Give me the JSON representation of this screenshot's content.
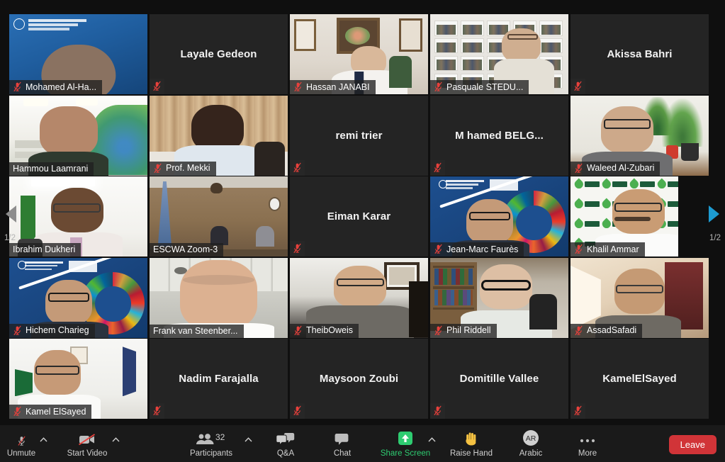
{
  "meeting": {
    "view": "gallery",
    "page_indicator_left": "1/2",
    "page_indicator_right": "1/2",
    "active_speaker": "Hammou Laamrani",
    "speaking_border_color": "#d7f205",
    "background_color": "#0f0f0f",
    "tile_color": "#242424"
  },
  "participants": [
    {
      "name": "Mohamed Al-Ha...",
      "video": true,
      "muted": true,
      "speaking": false,
      "bg": "fao-blue"
    },
    {
      "name": "Layale Gedeon",
      "video": false,
      "muted": true,
      "speaking": false,
      "bg": "none"
    },
    {
      "name": "Hassan JANABI",
      "video": true,
      "muted": true,
      "speaking": false,
      "bg": "room-art"
    },
    {
      "name": "Pasquale STEDU...",
      "video": true,
      "muted": true,
      "speaking": false,
      "bg": "bookshelf"
    },
    {
      "name": "Akissa Bahri",
      "video": false,
      "muted": true,
      "speaking": false,
      "bg": "none"
    },
    {
      "name": "Hammou Laamrani",
      "video": true,
      "muted": false,
      "speaking": true,
      "bg": "banner-light"
    },
    {
      "name": "Prof. Mekki",
      "video": true,
      "muted": true,
      "speaking": false,
      "bg": "curtain"
    },
    {
      "name": "remi trier",
      "video": false,
      "muted": true,
      "speaking": false,
      "bg": "none"
    },
    {
      "name": "M hamed BELG...",
      "video": false,
      "muted": true,
      "speaking": false,
      "bg": "none"
    },
    {
      "name": "Waleed Al-Zubari",
      "video": true,
      "muted": true,
      "speaking": false,
      "bg": "plants"
    },
    {
      "name": "Ibrahim Dukheri",
      "video": true,
      "muted": false,
      "speaking": false,
      "bg": "office-white"
    },
    {
      "name": "ESCWA Zoom-3",
      "video": true,
      "muted": false,
      "speaking": false,
      "bg": "conference"
    },
    {
      "name": "Eiman Karar",
      "video": false,
      "muted": true,
      "speaking": false,
      "bg": "none"
    },
    {
      "name": "Jean-Marc Faurès",
      "video": true,
      "muted": true,
      "speaking": false,
      "bg": "fao-sdg"
    },
    {
      "name": "Khalil Ammar",
      "video": true,
      "muted": true,
      "speaking": false,
      "bg": "icba"
    },
    {
      "name": "Hichem Charieg",
      "video": true,
      "muted": true,
      "speaking": false,
      "bg": "fao-sdg"
    },
    {
      "name": "Frank van Steenber...",
      "video": true,
      "muted": false,
      "speaking": false,
      "bg": "ceiling"
    },
    {
      "name": "TheibOweis",
      "video": true,
      "muted": true,
      "speaking": false,
      "bg": "dark-room"
    },
    {
      "name": "Phil Riddell",
      "video": true,
      "muted": true,
      "speaking": false,
      "bg": "library"
    },
    {
      "name": "AssadSafadi",
      "video": true,
      "muted": true,
      "speaking": false,
      "bg": "warm-room"
    },
    {
      "name": "Kamel ElSayed",
      "video": true,
      "muted": true,
      "speaking": false,
      "bg": "flags-white"
    },
    {
      "name": "Nadim Farajalla",
      "video": false,
      "muted": true,
      "speaking": false,
      "bg": "none"
    },
    {
      "name": "Maysoon Zoubi",
      "video": false,
      "muted": true,
      "speaking": false,
      "bg": "none"
    },
    {
      "name": "Domitille Vallee",
      "video": false,
      "muted": true,
      "speaking": false,
      "bg": "none"
    },
    {
      "name": "KamelElSayed",
      "video": false,
      "muted": true,
      "speaking": false,
      "bg": "none"
    }
  ],
  "toolbar": {
    "unmute_label": "Unmute",
    "start_video_label": "Start Video",
    "participants_label": "Participants",
    "participants_count": "32",
    "qa_label": "Q&A",
    "chat_label": "Chat",
    "share_screen_label": "Share Screen",
    "share_screen_color": "#2ecc71",
    "raise_hand_label": "Raise Hand",
    "language_label": "Arabic",
    "language_badge": "AR",
    "more_label": "More",
    "leave_label": "Leave",
    "leave_color": "#d13438"
  }
}
